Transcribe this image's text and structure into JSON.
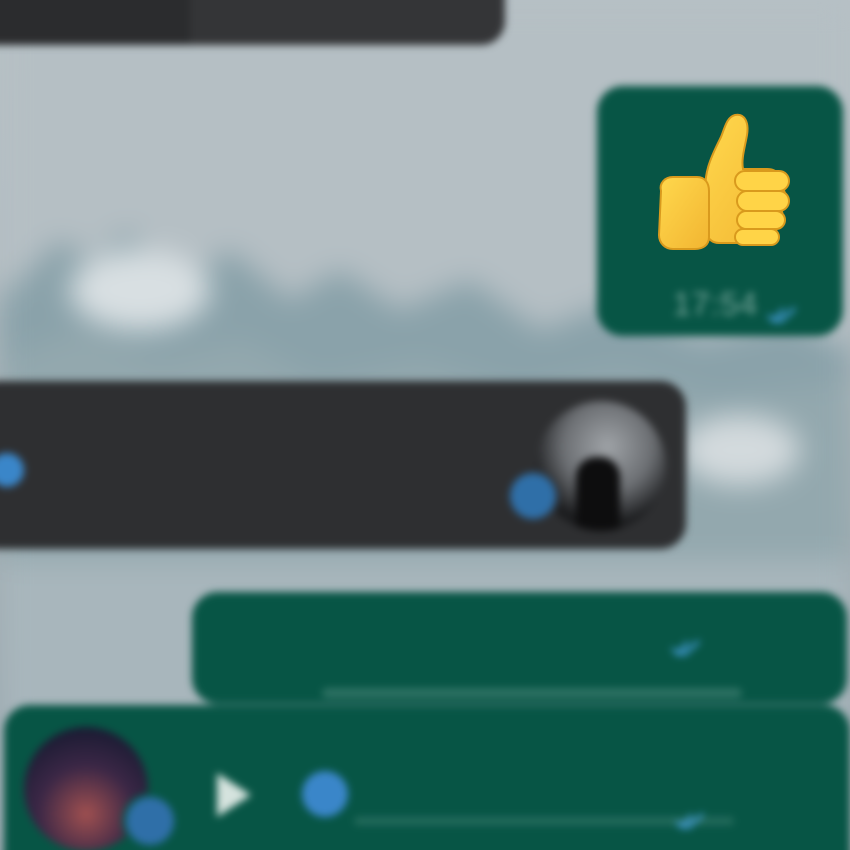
{
  "wallpaper": {
    "description_colors": {
      "sky": "#b7c1c6",
      "mountains": "#7f9aa3",
      "fog": "#c9d1d5"
    }
  },
  "colors": {
    "outgoing_bubble": "#075545",
    "incoming_bubble": "#2e2f31",
    "read_ticks": "#4aa3e6"
  },
  "messages": {
    "top": {
      "caption": ""
    },
    "emoji": {
      "emoji": "👍",
      "time": "17:54",
      "status_icon": "double-check-icon"
    },
    "incoming_voice": {
      "status_icon": "microphone-badge-icon"
    },
    "outgoing_text": {
      "status_icon": "double-check-icon"
    },
    "outgoing_voice": {
      "play_icon": "play-icon",
      "status_icon": "double-check-icon"
    }
  }
}
